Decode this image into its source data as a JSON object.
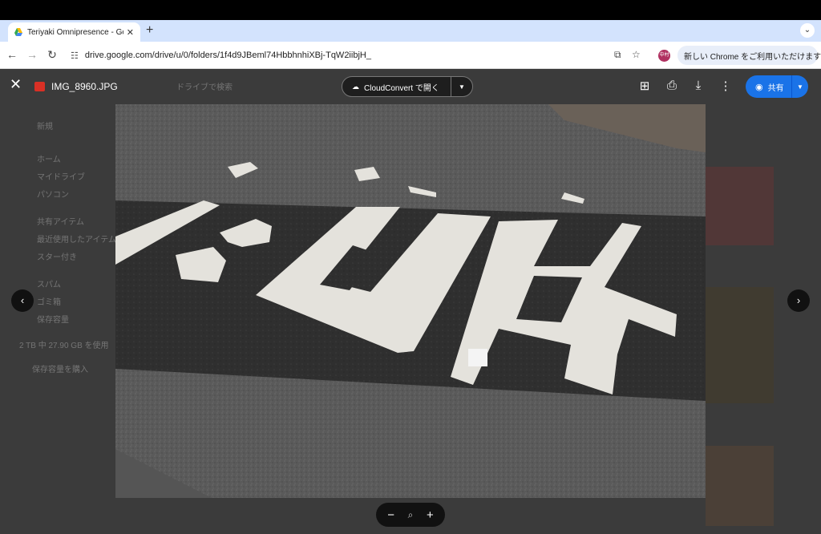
{
  "browser": {
    "tab": {
      "title": "Teriyaki Omnipresence - Goo",
      "close": "✕"
    },
    "new_tab": "+",
    "tab_menu": "⌄",
    "nav": {
      "back": "←",
      "forward": "→",
      "reload": "↻"
    },
    "url": "drive.google.com/drive/u/0/folders/1f4d9JBeml74HbbhnhiXBj-TqW2iibjH_",
    "avatar_label": "中村",
    "promo_text": "新しい Chrome をご利用いただけます",
    "promo_menu": "⋮"
  },
  "drive_background": {
    "search_placeholder": "ドライブで検索",
    "new_button": "新規",
    "nav_items": [
      "ホーム",
      "マイドライブ",
      "パソコン",
      "共有アイテム",
      "最近使用したアイテム",
      "スター付き",
      "スパム",
      "ゴミ箱",
      "保存容量"
    ],
    "storage_text": "2 TB 中 27.90 GB を使用",
    "storage_button": "保存容量を購入"
  },
  "viewer": {
    "close_icon": "✕",
    "file_name": "IMG_8960.JPG",
    "open_with_label": "CloudConvert で開く",
    "share_label": "共有",
    "prev": "‹",
    "next": "›",
    "zoom_out": "−",
    "zoom_in": "+"
  },
  "colors": {
    "tabstrip": "#d3e3fd",
    "share_blue": "#1a73e8",
    "file_icon_red": "#d93025",
    "viewer_bg": "#3b3b3b"
  }
}
